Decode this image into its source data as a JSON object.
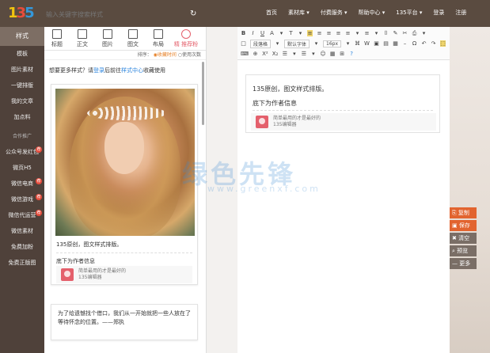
{
  "topbar": {
    "logo": "135",
    "search_placeholder": "输入关键字搜索样式",
    "refresh_icon": "↻",
    "nav": [
      "首页",
      "素材库 ▾",
      "付费服务 ▾",
      "帮助中心 ▾",
      "135平台 ▾",
      "登录",
      "注册"
    ]
  },
  "sidebar": {
    "items": [
      {
        "label": "样式",
        "active": true
      },
      {
        "label": "模板"
      },
      {
        "label": "图片素材"
      },
      {
        "label": "一键排版"
      },
      {
        "label": "我的文章"
      },
      {
        "label": "加点料"
      }
    ],
    "section_label": "合作推广",
    "promo_items": [
      {
        "label": "公众号发红包",
        "badge": "荐"
      },
      {
        "label": "微页H5"
      },
      {
        "label": "微信电商",
        "badge": "荐"
      },
      {
        "label": "微信游戏",
        "badge": "荐"
      },
      {
        "label": "微信代运营",
        "badge": "荐"
      },
      {
        "label": "微信素材"
      },
      {
        "label": "免费加粉"
      },
      {
        "label": "免费正版图"
      }
    ]
  },
  "panel": {
    "tabs": [
      "标题",
      "正文",
      "图片",
      "图文",
      "布局",
      "精 推荐粉"
    ],
    "sort_label": "排序：",
    "sort_options": [
      "◉收藏时间",
      "○使用次数"
    ],
    "hint_prefix": "想要更多样式？请",
    "hint_login": "登录",
    "hint_mid": "后前往",
    "hint_center": "样式中心",
    "hint_suffix": "收藏使用",
    "card1": {
      "line1": "135原创，图文样式排版。",
      "line2": "底下为作者信息",
      "author_line1": "简单最用的才是最好的",
      "author_line2": "135编辑器"
    },
    "card2": {
      "text": "为了给遗憾找个借口，我们从一开始就把一些人放在了等待怀念的位置。——郑执"
    }
  },
  "toolbar": {
    "row1": [
      "B",
      "I",
      "U",
      "A",
      "▾",
      "T",
      "▾",
      "≡",
      "≡",
      "≡",
      "≡",
      "≡",
      "▾",
      "≡",
      "▾",
      "⌷",
      "✎",
      "✂",
      "⎙",
      "▾"
    ],
    "row2": [
      "□",
      "段落格",
      "▾",
      "默认字体",
      "▾",
      "16px",
      "▾",
      "⌘",
      "W",
      "▣",
      "▤",
      "▦",
      "–",
      "Ω",
      "↶",
      "↷",
      "⬚"
    ],
    "row3": [
      "⌨",
      "⊕",
      "X²",
      "X₂",
      "☰",
      "▾",
      "☰",
      "▾",
      "☺",
      "▦",
      "⊞",
      "?"
    ]
  },
  "editor": {
    "line1": "135原创，图文样式排版。",
    "line2": "底下为作者信息",
    "author_line1": "简单最用的才是最好的",
    "author_line2": "135编辑器"
  },
  "watermark": {
    "main": "绿色先锋",
    "sub": "www.greenxf.com"
  },
  "actions": [
    {
      "label": "复制",
      "icon": "copy-icon",
      "glyph": "⎘"
    },
    {
      "label": "保存",
      "icon": "save-icon",
      "glyph": "▣"
    },
    {
      "label": "清空",
      "icon": "trash-icon",
      "glyph": "✖"
    },
    {
      "label": "预览",
      "icon": "search-icon",
      "glyph": "⌕"
    },
    {
      "label": "更多",
      "icon": "minus-icon",
      "glyph": "—"
    }
  ]
}
